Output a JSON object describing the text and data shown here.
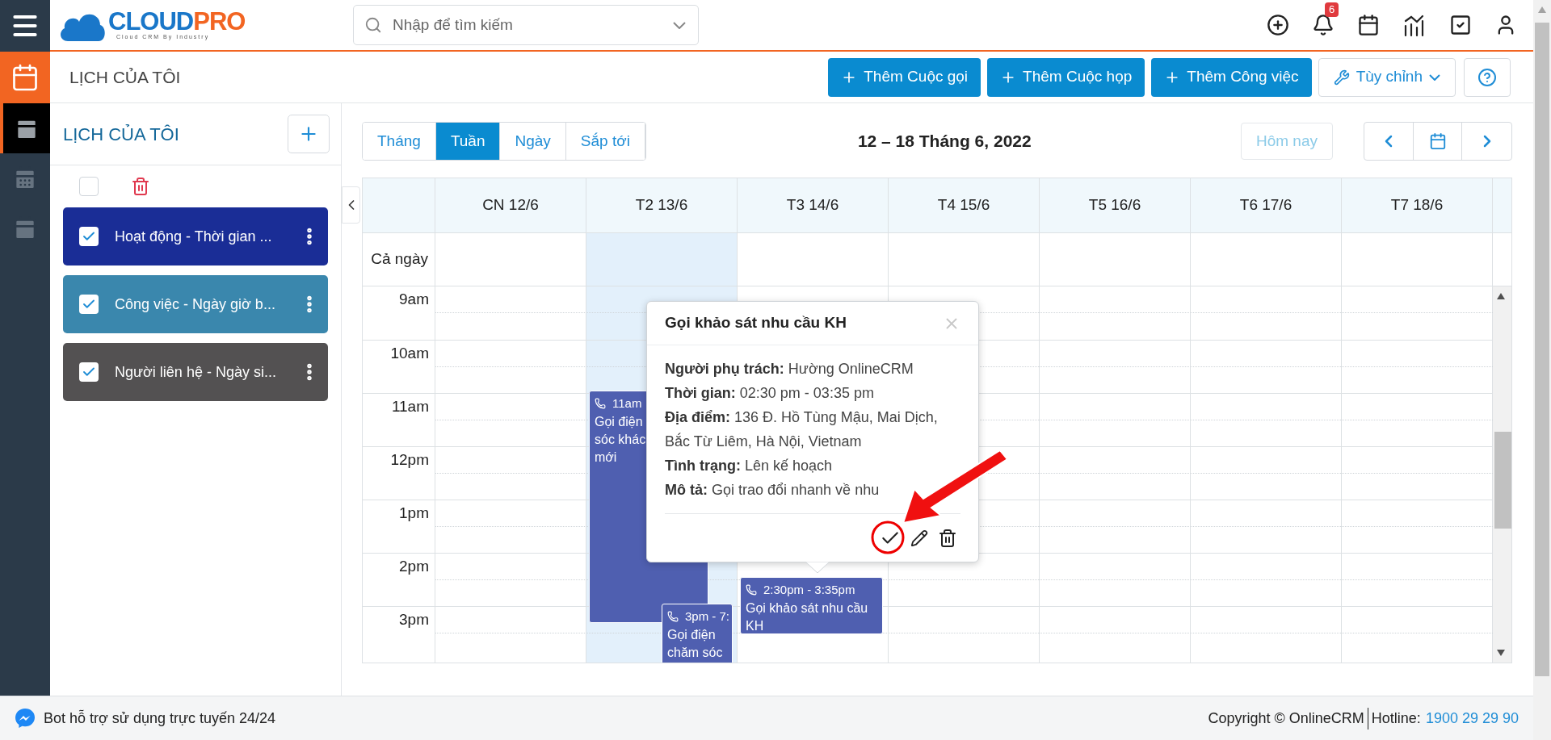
{
  "logo": {
    "primary": "CLOUD",
    "accent": "PRO",
    "tagline": "Cloud CRM By Industry"
  },
  "search": {
    "placeholder": "Nhập để tìm kiếm"
  },
  "notifications": {
    "count": "6"
  },
  "rail_items": [
    {
      "selected": true
    },
    {
      "selected": false
    },
    {
      "selected": false
    }
  ],
  "page_title": "LỊCH CỦA TÔI",
  "actions": [
    {
      "label": "Thêm Cuộc gọi",
      "kind": "primary"
    },
    {
      "label": "Thêm Cuộc họp",
      "kind": "primary"
    },
    {
      "label": "Thêm Công việc",
      "kind": "primary"
    },
    {
      "label": "Tùy chỉnh",
      "kind": "dropdown"
    }
  ],
  "sidebar": {
    "title": "LỊCH CỦA TÔI",
    "select_all_checked": false,
    "calendars": [
      {
        "label": "Hoạt động - Thời gian ...",
        "checked": true,
        "color": "#1a2d96"
      },
      {
        "label": "Công việc - Ngày giờ b...",
        "checked": true,
        "color": "#3a87ad"
      },
      {
        "label": "Người liên hệ - Ngày si...",
        "checked": true,
        "color": "#535152"
      }
    ]
  },
  "views": [
    {
      "label": "Tháng",
      "selected": false
    },
    {
      "label": "Tuần",
      "selected": true
    },
    {
      "label": "Ngày",
      "selected": false
    },
    {
      "label": "Sắp tới",
      "selected": false
    }
  ],
  "range_title": "12 – 18 Tháng 6, 2022",
  "today_button": {
    "label": "Hôm nay",
    "disabled": true
  },
  "days": [
    {
      "label": "CN 12/6",
      "today": false
    },
    {
      "label": "T2 13/6",
      "today": true
    },
    {
      "label": "T3 14/6",
      "today": false
    },
    {
      "label": "T4 15/6",
      "today": false
    },
    {
      "label": "T5 16/6",
      "today": false
    },
    {
      "label": "T6 17/6",
      "today": false
    },
    {
      "label": "T7 18/6",
      "today": false
    }
  ],
  "all_day_label": "Cả ngày",
  "hours": [
    "9am",
    "10am",
    "11am",
    "12pm",
    "1pm",
    "2pm",
    "3pm"
  ],
  "events": [
    {
      "time": "11am",
      "title_lines": [
        "Gọi điện",
        "sóc khác",
        "mới"
      ]
    },
    {
      "time": "3pm - 7:",
      "title_lines": [
        "Gọi điện",
        "chăm sóc"
      ]
    },
    {
      "time": "2:30pm - 3:35pm",
      "title_lines": [
        "Gọi khảo sát nhu cầu KH"
      ]
    }
  ],
  "popup": {
    "title": "Gọi khảo sát nhu cầu KH",
    "fields": [
      {
        "label": "Người phụ trách:",
        "value": "Hường OnlineCRM"
      },
      {
        "label": "Thời gian:",
        "value": "02:30 pm - 03:35 pm"
      },
      {
        "label": "Địa điểm:",
        "value": "136 Đ. Hồ Tùng Mậu, Mai Dịch, Bắc Từ Liêm, Hà Nội, Vietnam"
      },
      {
        "label": "Tình trạng:",
        "value": "Lên kế hoạch"
      },
      {
        "label": "Mô tả:",
        "value": "Gọi trao đổi nhanh về nhu"
      }
    ]
  },
  "footer": {
    "bot_text": "Bot hỗ trợ sử dụng trực tuyến 24/24",
    "copyright": "Copyright © OnlineCRM",
    "hotline_label": "Hotline:",
    "hotline": "1900 29 29 90"
  }
}
